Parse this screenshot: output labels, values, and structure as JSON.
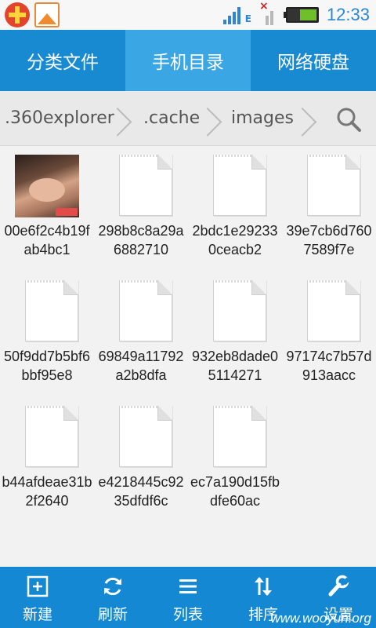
{
  "status_bar": {
    "time": "12:33",
    "network_type": "E",
    "battery_level": 0.55
  },
  "tabs": [
    {
      "label": "分类文件",
      "active": false
    },
    {
      "label": "手机目录",
      "active": true
    },
    {
      "label": "网络硬盘",
      "active": false
    }
  ],
  "breadcrumb": [
    ".360explorer",
    ".cache",
    "images"
  ],
  "files": [
    {
      "name": "00e6f2c4b19fab4bc1",
      "type": "image"
    },
    {
      "name": "298b8c8a29a6882710",
      "type": "file"
    },
    {
      "name": "2bdc1e292330ceacb2",
      "type": "file"
    },
    {
      "name": "39e7cb6d7607589f7e",
      "type": "file"
    },
    {
      "name": "50f9dd7b5bf6bbf95e8",
      "type": "file"
    },
    {
      "name": "69849a11792a2b8dfa",
      "type": "file"
    },
    {
      "name": "932eb8dade05114271",
      "type": "file"
    },
    {
      "name": "97174c7b57d913aacc",
      "type": "file"
    },
    {
      "name": "b44afdeae31b2f2640",
      "type": "file"
    },
    {
      "name": "e4218445c9235dfdf6c",
      "type": "file"
    },
    {
      "name": "ec7a190d15fbdfe60ac",
      "type": "file"
    }
  ],
  "toolbar": [
    {
      "label": "新建",
      "icon": "new-icon"
    },
    {
      "label": "刷新",
      "icon": "refresh-icon"
    },
    {
      "label": "列表",
      "icon": "list-icon"
    },
    {
      "label": "排序",
      "icon": "sort-icon"
    },
    {
      "label": "设置",
      "icon": "settings-icon"
    }
  ],
  "watermark": "www.wooyun.org",
  "colors": {
    "primary": "#178ad2",
    "tab_active": "#3aa6e3",
    "toolbar": "#1488d2",
    "time": "#2a87d6"
  }
}
